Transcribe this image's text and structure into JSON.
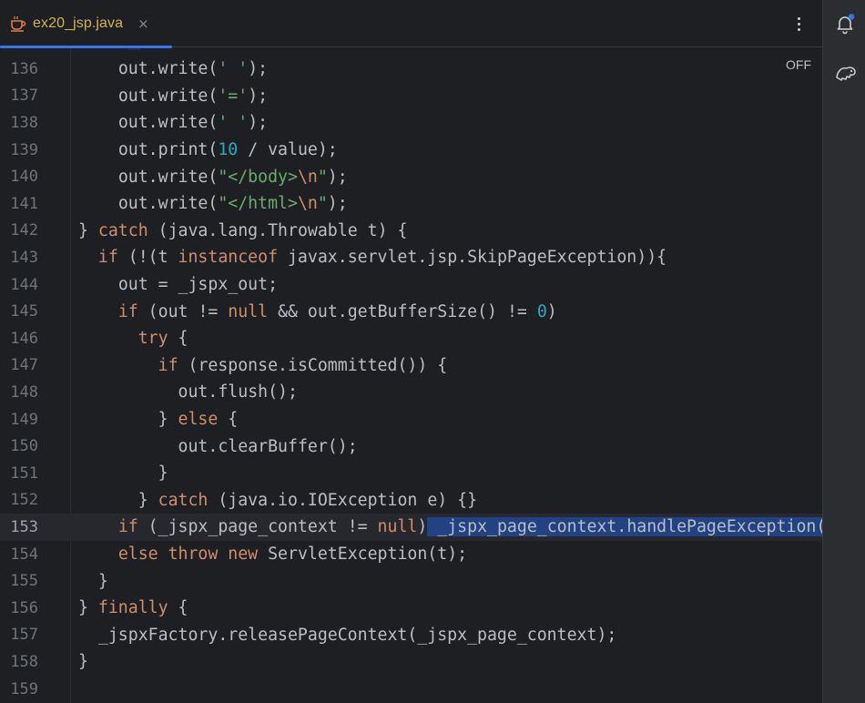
{
  "tab": {
    "file_name": "ex20_jsp.java",
    "close_glyph": "×",
    "icon": "coffee-cup-icon"
  },
  "editor": {
    "inspection_toggle": "OFF",
    "current_line": 153,
    "colors": {
      "keyword": "#cf8e6d",
      "number": "#2aacb8",
      "string": "#6aab73",
      "selection": "#214283",
      "default": "#bcbec4"
    },
    "lines": [
      {
        "n": "136",
        "code": "    out.write(' ');"
      },
      {
        "n": "137",
        "code": "    out.write('=');"
      },
      {
        "n": "138",
        "code": "    out.write(' ');"
      },
      {
        "n": "139",
        "code": "    out.print(10 / value);"
      },
      {
        "n": "140",
        "code": "    out.write(\"</body>\\n\");"
      },
      {
        "n": "141",
        "code": "    out.write(\"</html>\\n\");"
      },
      {
        "n": "142",
        "code": "} catch (java.lang.Throwable t) {"
      },
      {
        "n": "143",
        "code": "  if (!(t instanceof javax.servlet.jsp.SkipPageException)){"
      },
      {
        "n": "144",
        "code": "    out = _jspx_out;"
      },
      {
        "n": "145",
        "code": "    if (out != null && out.getBufferSize() != 0)"
      },
      {
        "n": "146",
        "code": "      try {"
      },
      {
        "n": "147",
        "code": "        if (response.isCommitted()) {"
      },
      {
        "n": "148",
        "code": "          out.flush();"
      },
      {
        "n": "149",
        "code": "        } else {"
      },
      {
        "n": "150",
        "code": "          out.clearBuffer();"
      },
      {
        "n": "151",
        "code": "        }"
      },
      {
        "n": "152",
        "code": "      } catch (java.io.IOException e) {}"
      },
      {
        "n": "153",
        "code": "    if (_jspx_page_context != null) _jspx_page_context.handlePageException(t);"
      },
      {
        "n": "154",
        "code": "    else throw new ServletException(t);"
      },
      {
        "n": "155",
        "code": "  }"
      },
      {
        "n": "156",
        "code": "} finally {"
      },
      {
        "n": "157",
        "code": "  _jspxFactory.releasePageContext(_jspx_page_context);"
      },
      {
        "n": "158",
        "code": "}"
      },
      {
        "n": "159",
        "code": ""
      }
    ]
  },
  "toolbar_right": {
    "notifications_icon": "bell-icon",
    "ai_assistant_icon": "ai-assistant-icon"
  }
}
